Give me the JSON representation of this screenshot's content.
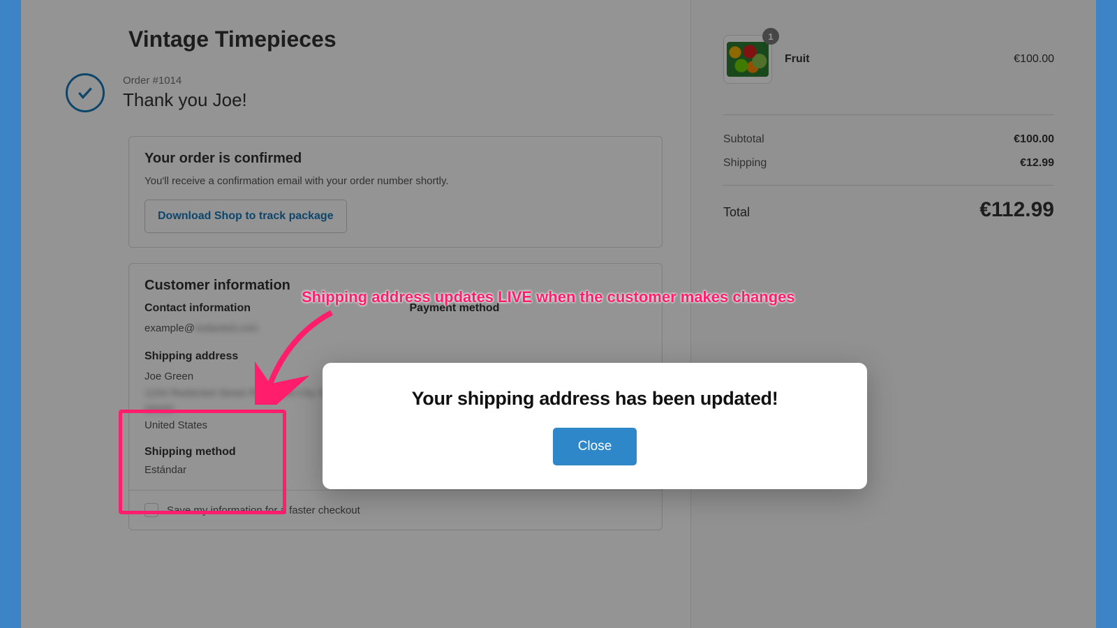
{
  "store": {
    "name": "Vintage Timepieces"
  },
  "order": {
    "number_label": "Order #1014",
    "thank_you": "Thank you Joe!"
  },
  "confirmed": {
    "heading": "Your order is confirmed",
    "body": "You'll receive a confirmation email with your order number shortly.",
    "cta": "Download Shop to track package"
  },
  "customer": {
    "heading": "Customer information",
    "contact_label": "Contact information",
    "contact_value_prefix": "example@",
    "payment_label": "Payment method",
    "shipping_addr_label": "Shipping address",
    "shipping_name": "Joe Green",
    "shipping_country": "United States",
    "shipping_method_label": "Shipping method",
    "shipping_method_value": "Estándar",
    "save_label": "Save my information for a faster checkout"
  },
  "cart": {
    "item": {
      "name": "Fruit",
      "qty": "1",
      "price": "€100.00"
    },
    "subtotal_label": "Subtotal",
    "subtotal_value": "€100.00",
    "shipping_label": "Shipping",
    "shipping_value": "€12.99",
    "total_label": "Total",
    "total_value": "€112.99"
  },
  "modal": {
    "title": "Your shipping address has been updated!",
    "close": "Close"
  },
  "annotation": {
    "text": "Shipping address updates LIVE when the customer makes changes"
  }
}
